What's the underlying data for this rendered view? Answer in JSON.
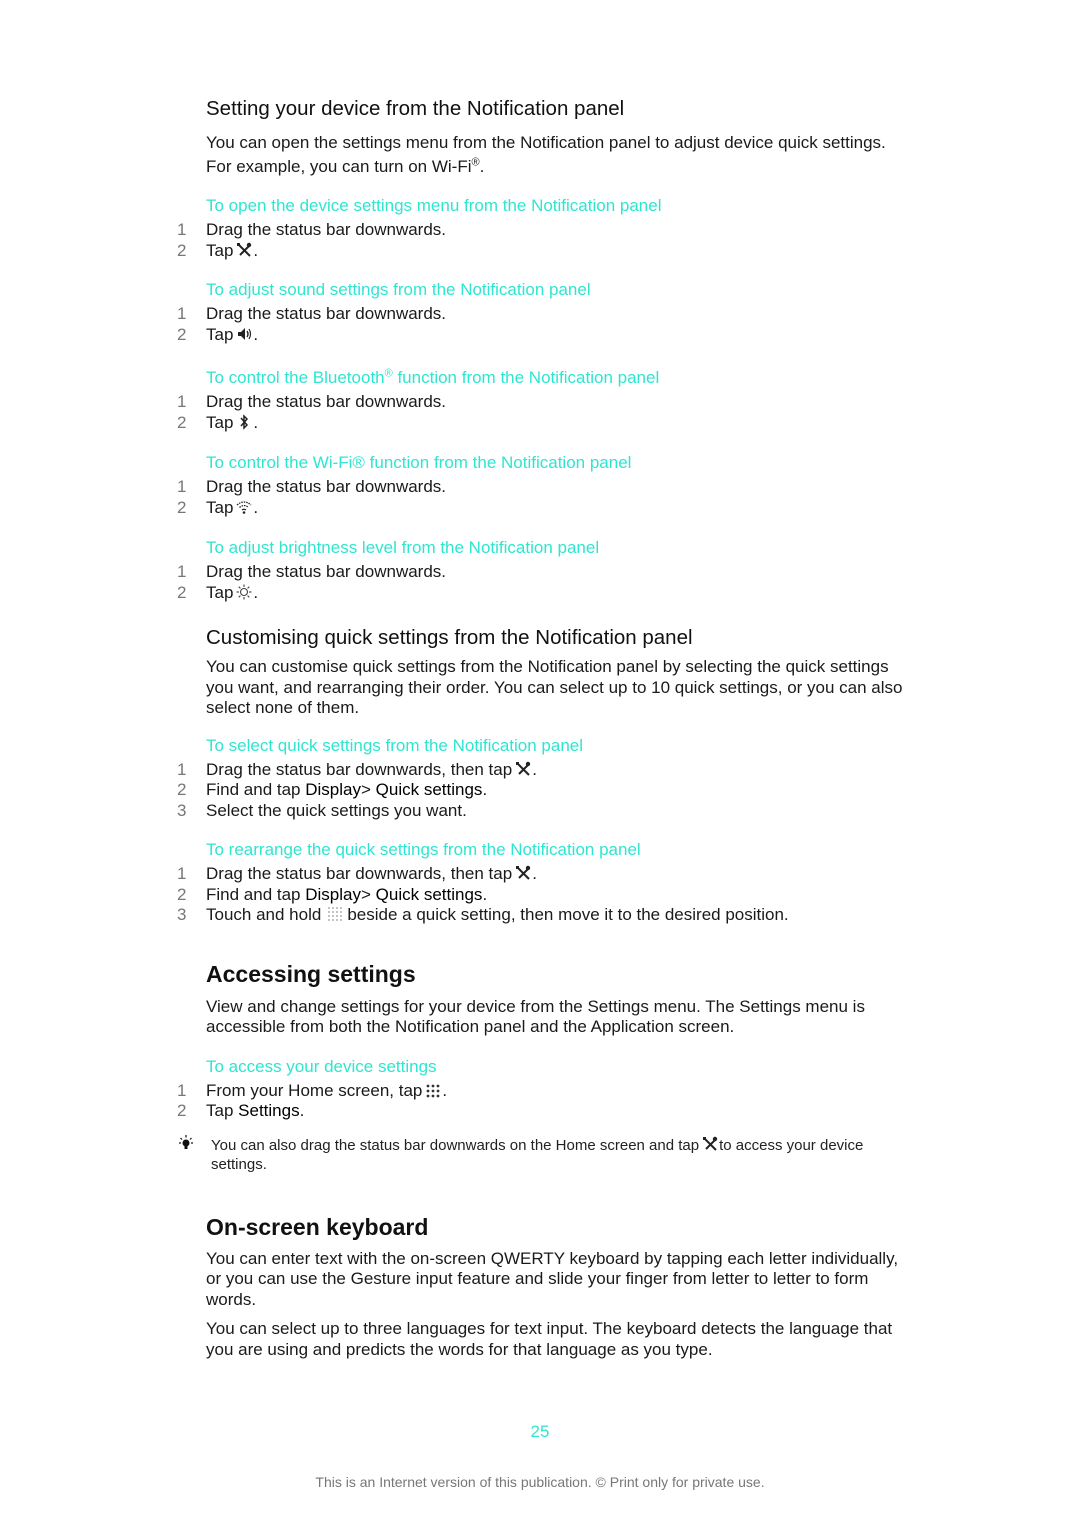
{
  "section1": {
    "title": "Setting your device from the Notification panel",
    "intro_before_sup": "You can open the settings menu from the Notification panel to adjust device quick settings. For example, you can turn on Wi-Fi",
    "intro_sup": "®",
    "intro_after_sup": ".",
    "procedures": [
      {
        "title": "To open the device settings menu from the Notification panel",
        "steps": [
          {
            "num": "1",
            "text": "Drag the status bar downwards."
          },
          {
            "num": "2",
            "text": "Tap",
            "icon": "settings-tools-icon",
            "after": "."
          }
        ]
      },
      {
        "title": "To adjust sound settings from the Notification panel",
        "steps": [
          {
            "num": "1",
            "text": "Drag the status bar downwards."
          },
          {
            "num": "2",
            "text": "Tap",
            "icon": "sound-icon",
            "after": "."
          }
        ]
      },
      {
        "title_before_sup": "To control the Bluetooth",
        "title_sup": "®",
        "title_after_sup": " function from the Notification panel",
        "steps": [
          {
            "num": "1",
            "text": "Drag the status bar downwards."
          },
          {
            "num": "2",
            "text": "Tap",
            "icon": "bluetooth-icon",
            "after": "."
          }
        ]
      },
      {
        "title": "To control the Wi-Fi® function from the Notification panel",
        "steps": [
          {
            "num": "1",
            "text": "Drag the status bar downwards."
          },
          {
            "num": "2",
            "text": "Tap",
            "icon": "wifi-icon",
            "after": "."
          }
        ]
      },
      {
        "title": "To adjust brightness level from the Notification panel",
        "steps": [
          {
            "num": "1",
            "text": "Drag the status bar downwards."
          },
          {
            "num": "2",
            "text": "Tap",
            "icon": "brightness-icon",
            "after": "."
          }
        ]
      }
    ]
  },
  "section2": {
    "title": "Customising quick settings from the Notification panel",
    "intro": "You can customise quick settings from the Notification panel by selecting the quick settings you want, and rearranging their order. You can select up to 10 quick settings, or you can also select none of them.",
    "procedures": [
      {
        "title": "To select quick settings from the Notification panel",
        "steps": [
          {
            "num": "1",
            "text": "Drag the status bar downwards, then tap",
            "icon": "settings-tools-icon",
            "after": "."
          },
          {
            "num": "2",
            "text": "Find and tap",
            "b1": "Display",
            "sep": ">",
            "b2": "Quick settings",
            "after": "."
          },
          {
            "num": "3",
            "text": "Select the quick settings you want."
          }
        ]
      },
      {
        "title": "To rearrange the quick settings from the Notification panel",
        "steps": [
          {
            "num": "1",
            "text": "Drag the status bar downwards, then tap",
            "icon": "settings-tools-icon",
            "after": "."
          },
          {
            "num": "2",
            "text": "Find and tap",
            "b1": "Display",
            "sep": ">",
            "b2": "Quick settings",
            "after": "."
          },
          {
            "num": "3",
            "text": "Touch and hold",
            "icon": "drag-handle-icon",
            "after": "beside a quick setting, then move it to the desired position."
          }
        ]
      }
    ]
  },
  "section3": {
    "title": "Accessing settings",
    "intro": "View and change settings for your device from the Settings menu. The Settings menu is accessible from both the Notification panel and the Application screen.",
    "procedure": {
      "title": "To access your device settings",
      "steps": [
        {
          "num": "1",
          "text": "From your Home screen, tap",
          "icon": "app-grid-icon",
          "after": "."
        },
        {
          "num": "2",
          "text": "Tap",
          "b1": "Settings",
          "after": "."
        }
      ]
    },
    "tip": {
      "icon": "tip-lightbulb-icon",
      "before": "You can also drag the status bar downwards on the Home screen and tap",
      "after": "to access your device settings."
    }
  },
  "section4": {
    "title": "On-screen keyboard",
    "paragraphs": [
      "You can enter text with the on-screen QWERTY keyboard by tapping each letter individually, or you can use the Gesture input feature and slide your finger from letter to letter to form words.",
      "You can select up to three languages for text input. The keyboard detects the language that you are using and predicts the words for that language as you type."
    ]
  },
  "footer": {
    "page_number": "25",
    "notice": "This is an Internet version of this publication. © Print only for private use."
  },
  "colors": {
    "accent": "#2ee6d0",
    "text": "#1a1a1a",
    "step_number": "#777777",
    "footer_text": "#777777"
  }
}
